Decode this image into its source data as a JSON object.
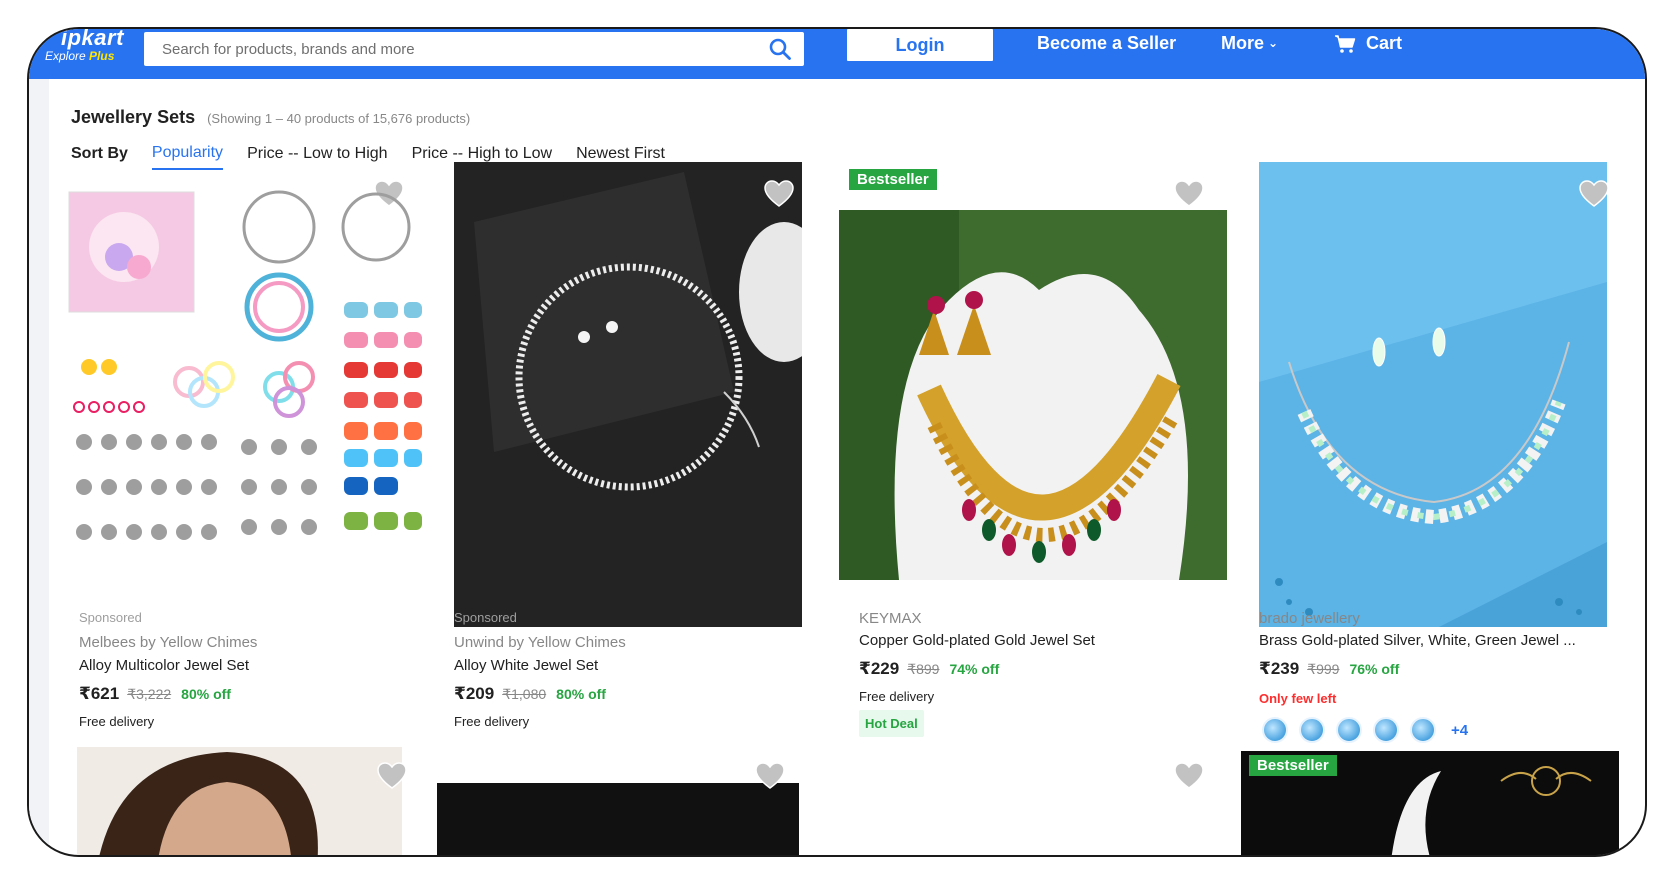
{
  "header": {
    "logo_brand": "ipkart",
    "logo_explore": "Explore",
    "logo_plus": "Plus",
    "search_placeholder": "Search for products, brands and more",
    "login_label": "Login",
    "seller_label": "Become a Seller",
    "more_label": "More",
    "cart_label": "Cart",
    "brand_color": "#2874f0"
  },
  "listing": {
    "title": "Jewellery Sets",
    "showing": "(Showing 1 – 40 products of 15,676 products)"
  },
  "sort": {
    "label": "Sort By",
    "options": [
      "Popularity",
      "Price -- Low to High",
      "Price -- High to Low",
      "Newest First"
    ],
    "active": "Popularity"
  },
  "products": [
    {
      "sponsored": "Sponsored",
      "brand": "Melbees by Yellow Chimes",
      "title": "Alloy Multicolor Jewel Set",
      "price": "₹621",
      "mrp": "₹3,222",
      "off": "80% off",
      "delivery": "Free delivery"
    },
    {
      "sponsored": "Sponsored",
      "brand": "Unwind by Yellow Chimes",
      "title": "Alloy White Jewel Set",
      "price": "₹209",
      "mrp": "₹1,080",
      "off": "80% off",
      "delivery": "Free delivery"
    },
    {
      "badge": "Bestseller",
      "brand": "KEYMAX",
      "title": "Copper Gold-plated Gold Jewel Set",
      "price": "₹229",
      "mrp": "₹899",
      "off": "74% off",
      "delivery": "Free delivery",
      "deal": "Hot Deal"
    },
    {
      "brand": "brado jewellery",
      "title": "Brass Gold-plated Silver, White, Green Jewel ...",
      "price": "₹239",
      "mrp": "₹999",
      "off": "76% off",
      "stock": "Only few left",
      "swatch_more": "+4"
    }
  ],
  "next_row": {
    "badge": "Bestseller"
  },
  "colors": {
    "accent": "#2874f0",
    "discount": "#26a541",
    "stock_warning": "#ff2d2d",
    "badge": "#26a541"
  }
}
